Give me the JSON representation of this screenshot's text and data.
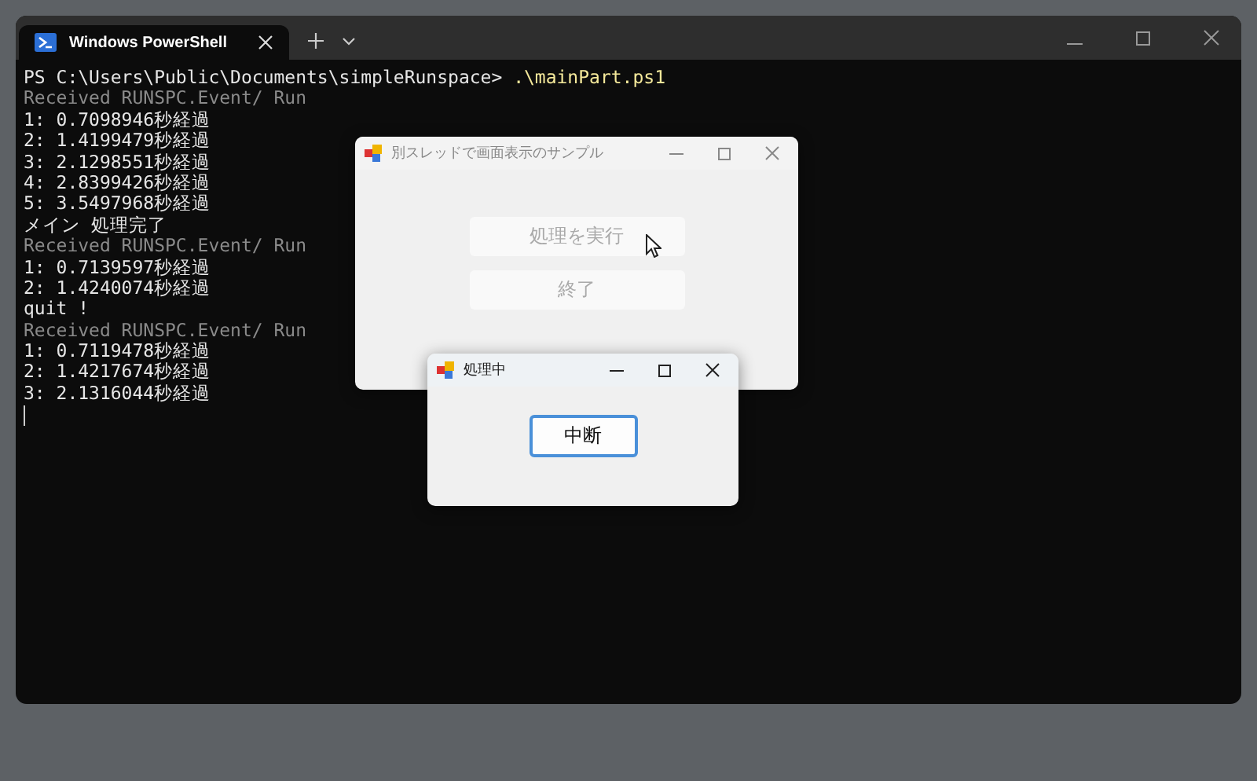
{
  "terminal": {
    "tab": {
      "title": "Windows PowerShell",
      "selected": true
    },
    "lines": [
      {
        "kind": "prompt",
        "text": "PS C:\\Users\\Public\\Documents\\simpleRunspace> ",
        "command": ".\\mainPart.ps1"
      },
      {
        "kind": "info",
        "text": "Received RUNSPC.Event/ Run"
      },
      {
        "kind": "output",
        "text": "1: 0.7098946秒経過"
      },
      {
        "kind": "output",
        "text": "2: 1.4199479秒経過"
      },
      {
        "kind": "output",
        "text": "3: 2.1298551秒経過"
      },
      {
        "kind": "output",
        "text": "4: 2.8399426秒経過"
      },
      {
        "kind": "output",
        "text": "5: 3.5497968秒経過"
      },
      {
        "kind": "output",
        "text": "メイン 処理完了"
      },
      {
        "kind": "info",
        "text": "Received RUNSPC.Event/ Run"
      },
      {
        "kind": "output",
        "text": "1: 0.7139597秒経過"
      },
      {
        "kind": "output",
        "text": "2: 1.4240074秒経過"
      },
      {
        "kind": "output",
        "text": "quit !"
      },
      {
        "kind": "info",
        "text": "Received RUNSPC.Event/ Run"
      },
      {
        "kind": "output",
        "text": "1: 0.7119478秒経過"
      },
      {
        "kind": "output",
        "text": "2: 1.4217674秒経過"
      },
      {
        "kind": "output",
        "text": "3: 2.1316044秒経過"
      }
    ]
  },
  "main_form": {
    "title": "別スレッドで画面表示のサンプル",
    "buttons": [
      {
        "label": "処理を実行",
        "disabled": true
      },
      {
        "label": "終了",
        "disabled": true
      }
    ]
  },
  "progress_form": {
    "title": "処理中",
    "button": {
      "label": "中断",
      "focused": true
    }
  }
}
